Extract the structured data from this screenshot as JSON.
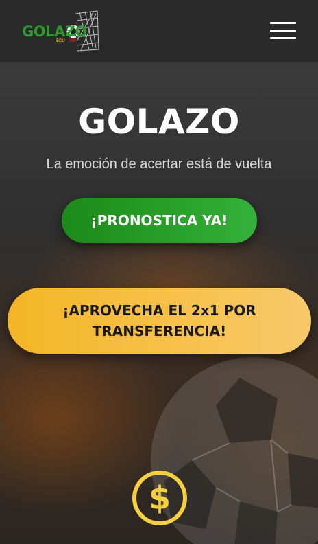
{
  "header": {
    "logo_text": "GOLAZO",
    "logo_sub_left": "ECU",
    "logo_sub_right": "OR",
    "menu_icon": "hamburger-menu-icon"
  },
  "hero": {
    "title": "GOLAZO",
    "subtitle": "La emoción de acertar está de vuelta",
    "predict_button": "¡PRONOSTICA YA!",
    "promo_button": "¡APROVECHA EL 2x1 POR TRANSFERENCIA!",
    "coin_icon": "dollar-coin-icon"
  },
  "colors": {
    "header_bg": "#2a2a2a",
    "predict_green": "#2aa12a",
    "promo_yellow": "#f4b525",
    "coin_yellow": "#f5d03c",
    "logo_green": "#2c9a2c"
  }
}
